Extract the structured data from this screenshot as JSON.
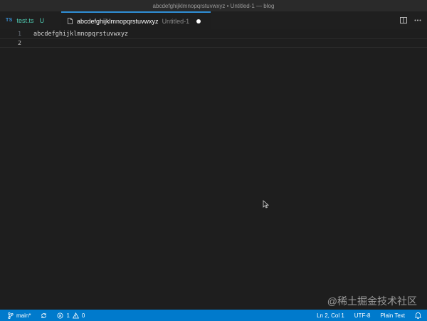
{
  "window": {
    "title": "abcdefghijklmnopqrstuvwxyz • Untitled-1 — blog"
  },
  "tabs": [
    {
      "badge": "TS",
      "name": "test.ts",
      "status": "U"
    },
    {
      "name": "abcdefghijklmnopqrstuvwxyz",
      "description": "Untitled-1",
      "dirty": true
    }
  ],
  "editor": {
    "lines": [
      {
        "number": "1",
        "text": "abcdefghijklmnopqrstuvwxyz"
      },
      {
        "number": "2",
        "text": ""
      }
    ]
  },
  "statusbar": {
    "branch": "main*",
    "errors": "1",
    "warnings": "0",
    "position": "Ln 2, Col 1",
    "encoding": "UTF-8",
    "language": "Plain Text",
    "color": "#007acc"
  },
  "watermark": "@稀土掘金技术社区",
  "icons": [
    "source-control-branch-icon",
    "sync-icon",
    "error-icon",
    "warning-icon",
    "split-editor-icon",
    "more-actions-icon",
    "file-icon",
    "bell-icon",
    "mouse-pointer-icon"
  ]
}
